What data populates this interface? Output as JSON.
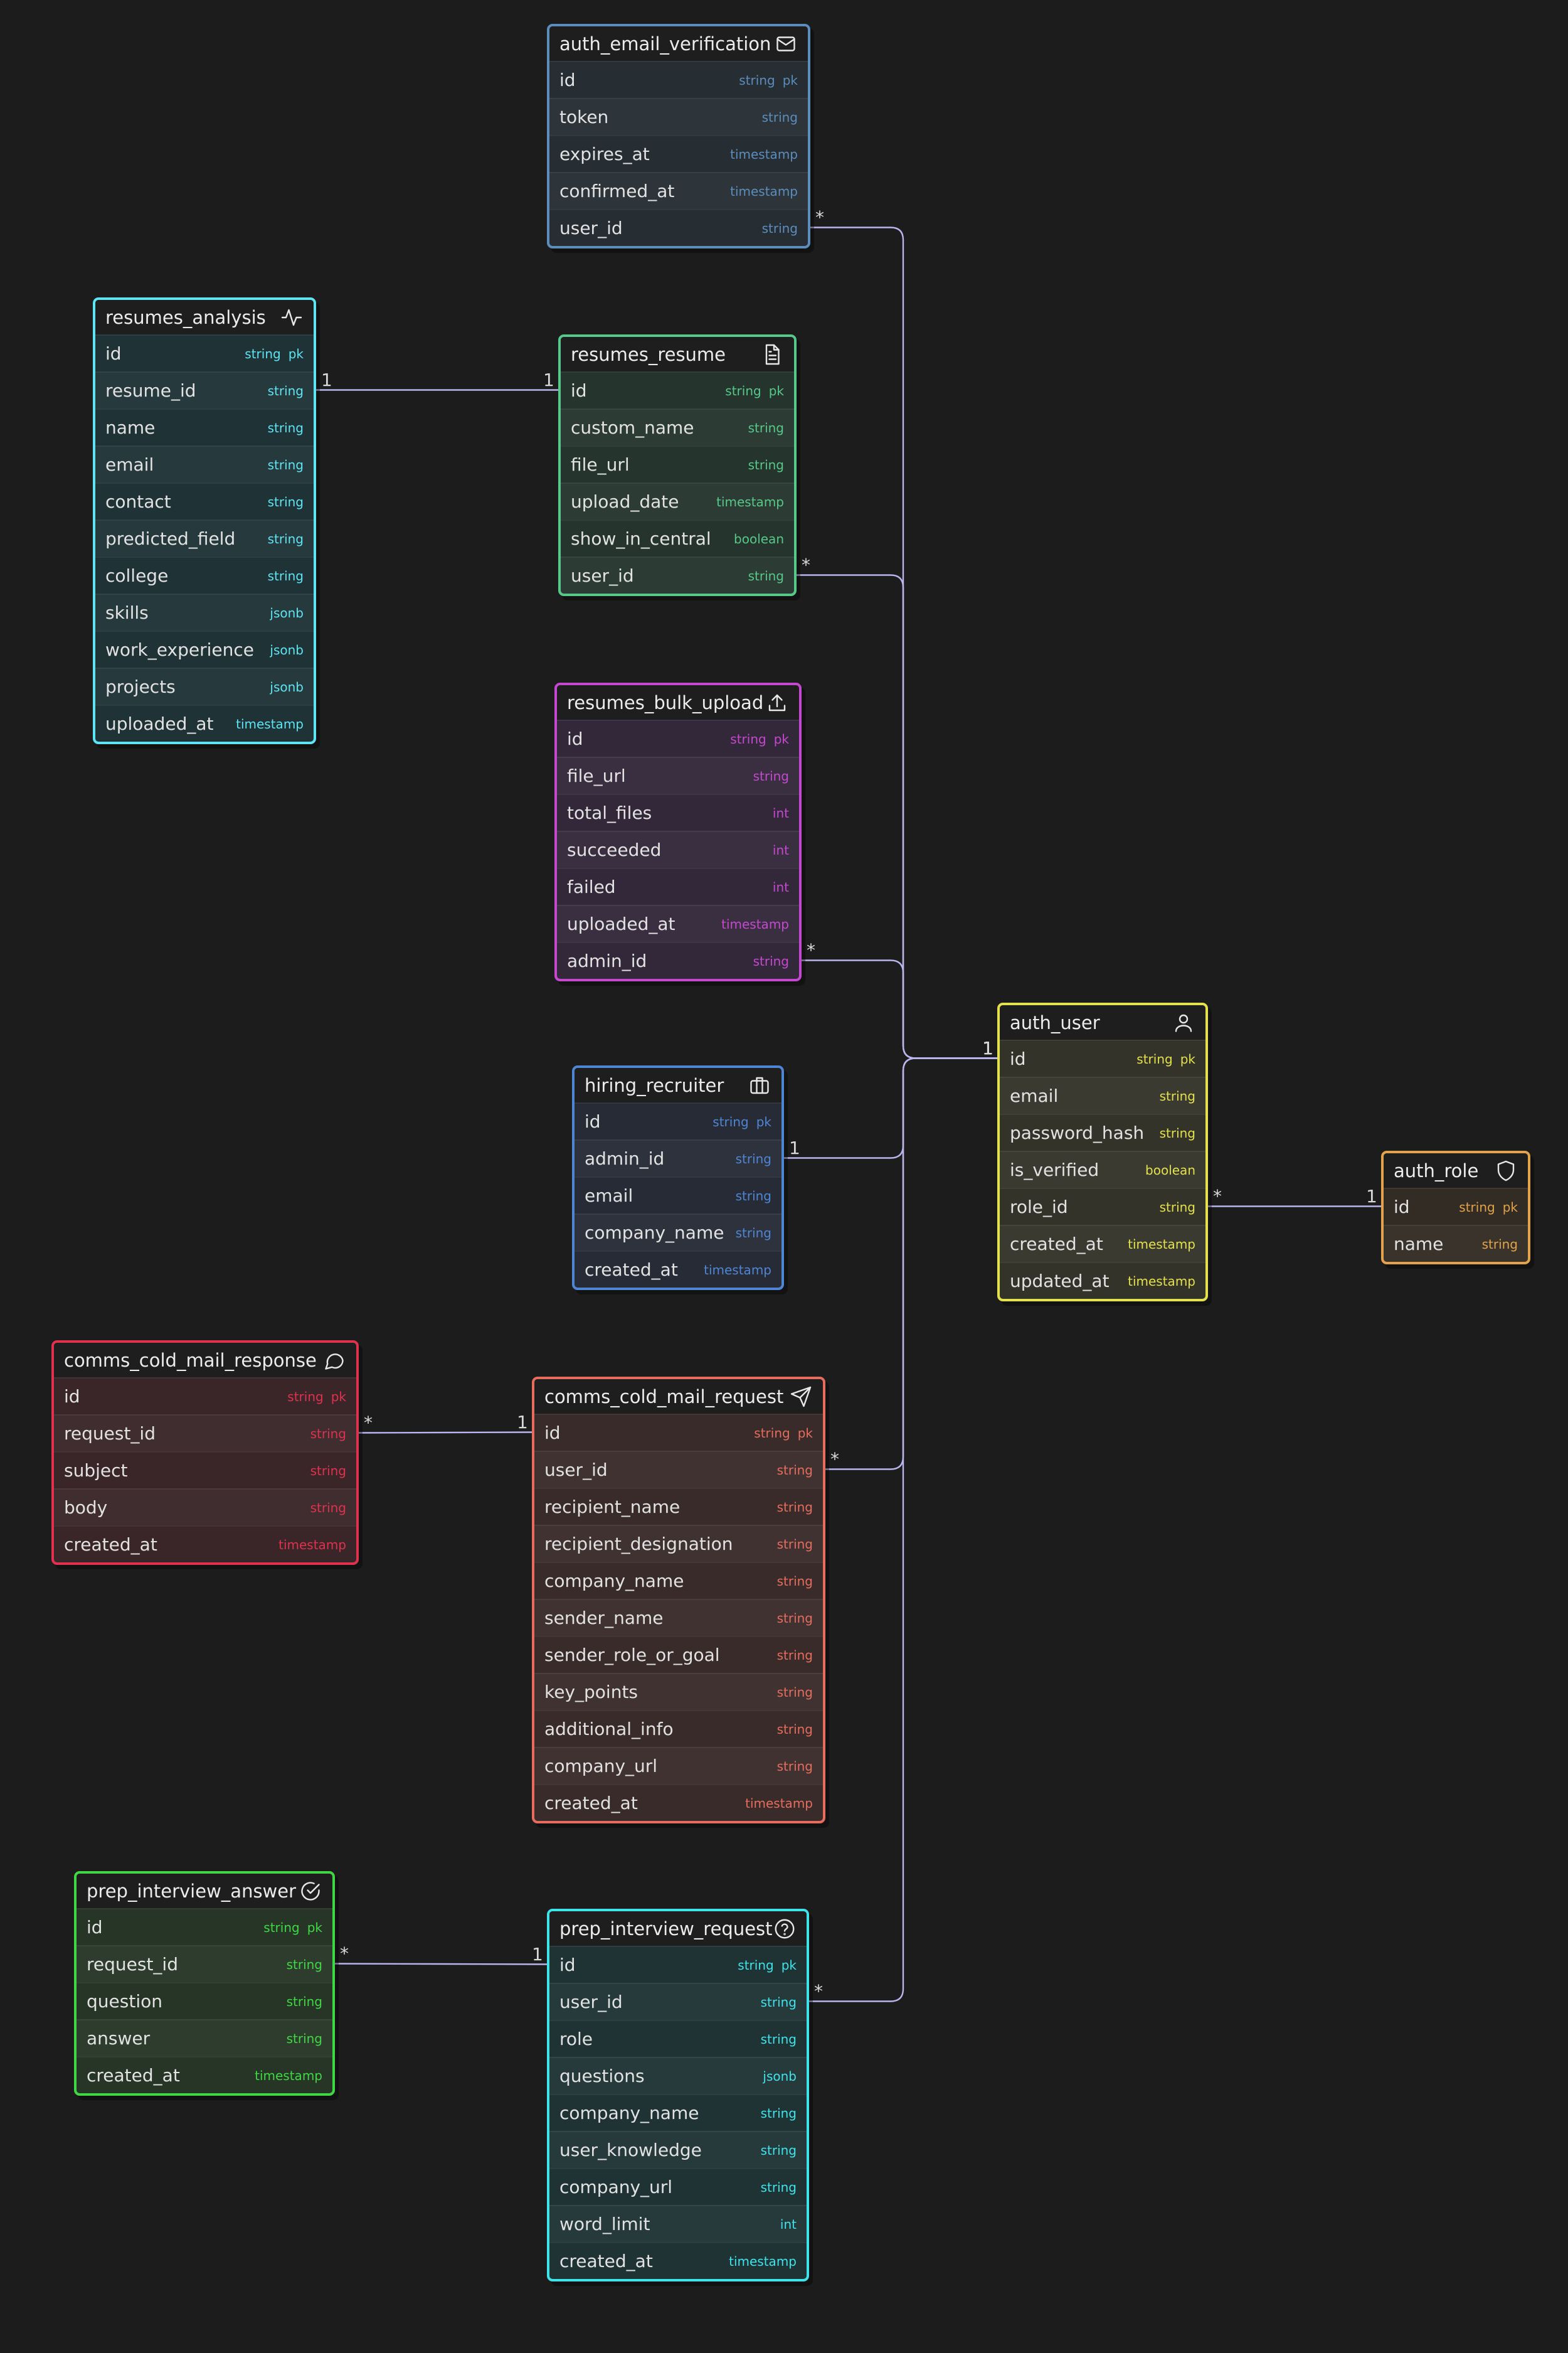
{
  "tables": [
    {
      "name": "auth_email_verification",
      "icon": "mail-icon",
      "color": "#5c8dbd",
      "bg": "#262e33",
      "fields": [
        {
          "name": "id",
          "type": "string",
          "pk": "pk"
        },
        {
          "name": "token",
          "type": "string"
        },
        {
          "name": "expires_at",
          "type": "timestamp"
        },
        {
          "name": "confirmed_at",
          "type": "timestamp"
        },
        {
          "name": "user_id",
          "type": "string"
        }
      ]
    },
    {
      "name": "resumes_analysis",
      "icon": "activity-icon",
      "color": "#5ee4f2",
      "bg": "#1f3236",
      "fields": [
        {
          "name": "id",
          "type": "string",
          "pk": "pk"
        },
        {
          "name": "resume_id",
          "type": "string"
        },
        {
          "name": "name",
          "type": "string"
        },
        {
          "name": "email",
          "type": "string"
        },
        {
          "name": "contact",
          "type": "string"
        },
        {
          "name": "predicted_field",
          "type": "string"
        },
        {
          "name": "college",
          "type": "string"
        },
        {
          "name": "skills",
          "type": "jsonb"
        },
        {
          "name": "work_experience",
          "type": "jsonb"
        },
        {
          "name": "projects",
          "type": "jsonb"
        },
        {
          "name": "uploaded_at",
          "type": "timestamp"
        }
      ]
    },
    {
      "name": "resumes_resume",
      "icon": "document-icon",
      "color": "#56c98a",
      "bg": "#25342c",
      "fields": [
        {
          "name": "id",
          "type": "string",
          "pk": "pk"
        },
        {
          "name": "custom_name",
          "type": "string"
        },
        {
          "name": "file_url",
          "type": "string"
        },
        {
          "name": "upload_date",
          "type": "timestamp"
        },
        {
          "name": "show_in_central",
          "type": "boolean"
        },
        {
          "name": "user_id",
          "type": "string"
        }
      ]
    },
    {
      "name": "resumes_bulk_upload",
      "icon": "upload-icon",
      "color": "#c548d0",
      "bg": "#33283a",
      "fields": [
        {
          "name": "id",
          "type": "string",
          "pk": "pk"
        },
        {
          "name": "file_url",
          "type": "string"
        },
        {
          "name": "total_files",
          "type": "int"
        },
        {
          "name": "succeeded",
          "type": "int"
        },
        {
          "name": "failed",
          "type": "int"
        },
        {
          "name": "uploaded_at",
          "type": "timestamp"
        },
        {
          "name": "admin_id",
          "type": "string"
        }
      ]
    },
    {
      "name": "hiring_recruiter",
      "icon": "briefcase-icon",
      "color": "#4f86d4",
      "bg": "#262b36",
      "fields": [
        {
          "name": "id",
          "type": "string",
          "pk": "pk"
        },
        {
          "name": "admin_id",
          "type": "string"
        },
        {
          "name": "email",
          "type": "string"
        },
        {
          "name": "company_name",
          "type": "string"
        },
        {
          "name": "created_at",
          "type": "timestamp"
        }
      ]
    },
    {
      "name": "auth_user",
      "icon": "user-icon",
      "color": "#e4e14c",
      "bg": "#33332a",
      "fields": [
        {
          "name": "id",
          "type": "string",
          "pk": "pk"
        },
        {
          "name": "email",
          "type": "string"
        },
        {
          "name": "password_hash",
          "type": "string"
        },
        {
          "name": "is_verified",
          "type": "boolean"
        },
        {
          "name": "role_id",
          "type": "string"
        },
        {
          "name": "created_at",
          "type": "timestamp"
        },
        {
          "name": "updated_at",
          "type": "timestamp"
        }
      ]
    },
    {
      "name": "auth_role",
      "icon": "shield-icon",
      "color": "#e2a34a",
      "bg": "#322c25",
      "fields": [
        {
          "name": "id",
          "type": "string",
          "pk": "pk"
        },
        {
          "name": "name",
          "type": "string"
        }
      ]
    },
    {
      "name": "comms_cold_mail_response",
      "icon": "message-icon",
      "color": "#e0314e",
      "bg": "#3a2629",
      "fields": [
        {
          "name": "id",
          "type": "string",
          "pk": "pk"
        },
        {
          "name": "request_id",
          "type": "string"
        },
        {
          "name": "subject",
          "type": "string"
        },
        {
          "name": "body",
          "type": "string"
        },
        {
          "name": "created_at",
          "type": "timestamp"
        }
      ]
    },
    {
      "name": "comms_cold_mail_request",
      "icon": "send-icon",
      "color": "#e66d5e",
      "bg": "#382b2a",
      "fields": [
        {
          "name": "id",
          "type": "string",
          "pk": "pk"
        },
        {
          "name": "user_id",
          "type": "string"
        },
        {
          "name": "recipient_name",
          "type": "string"
        },
        {
          "name": "recipient_designation",
          "type": "string"
        },
        {
          "name": "company_name",
          "type": "string"
        },
        {
          "name": "sender_name",
          "type": "string"
        },
        {
          "name": "sender_role_or_goal",
          "type": "string"
        },
        {
          "name": "key_points",
          "type": "string"
        },
        {
          "name": "additional_info",
          "type": "string"
        },
        {
          "name": "company_url",
          "type": "string"
        },
        {
          "name": "created_at",
          "type": "timestamp"
        }
      ]
    },
    {
      "name": "prep_interview_answer",
      "icon": "check-circle-icon",
      "color": "#3fd844",
      "bg": "#263526",
      "fields": [
        {
          "name": "id",
          "type": "string",
          "pk": "pk"
        },
        {
          "name": "request_id",
          "type": "string"
        },
        {
          "name": "question",
          "type": "string"
        },
        {
          "name": "answer",
          "type": "string"
        },
        {
          "name": "created_at",
          "type": "timestamp"
        }
      ]
    },
    {
      "name": "prep_interview_request",
      "icon": "help-circle-icon",
      "color": "#3fe3ea",
      "bg": "#1f3335",
      "fields": [
        {
          "name": "id",
          "type": "string",
          "pk": "pk"
        },
        {
          "name": "user_id",
          "type": "string"
        },
        {
          "name": "role",
          "type": "string"
        },
        {
          "name": "questions",
          "type": "jsonb"
        },
        {
          "name": "company_name",
          "type": "string"
        },
        {
          "name": "user_knowledge",
          "type": "string"
        },
        {
          "name": "company_url",
          "type": "string"
        },
        {
          "name": "word_limit",
          "type": "int"
        },
        {
          "name": "created_at",
          "type": "timestamp"
        }
      ]
    }
  ],
  "relations": [
    {
      "from": "auth_email_verification",
      "from_field": "user_id",
      "from_card": "*",
      "to": "auth_user",
      "to_field": "id",
      "to_card": "1"
    },
    {
      "from": "resumes_resume",
      "from_field": "user_id",
      "from_card": "*",
      "to": "auth_user",
      "to_field": "id",
      "to_card": "1"
    },
    {
      "from": "resumes_bulk_upload",
      "from_field": "admin_id",
      "from_card": "*",
      "to": "auth_user",
      "to_field": "id",
      "to_card": "1"
    },
    {
      "from": "hiring_recruiter",
      "from_field": "admin_id",
      "from_card": "1",
      "to": "auth_user",
      "to_field": "id",
      "to_card": "1"
    },
    {
      "from": "comms_cold_mail_request",
      "from_field": "user_id",
      "from_card": "*",
      "to": "auth_user",
      "to_field": "id",
      "to_card": "1"
    },
    {
      "from": "prep_interview_request",
      "from_field": "user_id",
      "from_card": "*",
      "to": "auth_user",
      "to_field": "id",
      "to_card": "1"
    },
    {
      "from": "resumes_analysis",
      "from_field": "resume_id",
      "from_card": "1",
      "to": "resumes_resume",
      "to_field": "id",
      "to_card": "1"
    },
    {
      "from": "auth_user",
      "from_field": "role_id",
      "from_card": "*",
      "to": "auth_role",
      "to_field": "id",
      "to_card": "1"
    },
    {
      "from": "comms_cold_mail_response",
      "from_field": "request_id",
      "from_card": "*",
      "to": "comms_cold_mail_request",
      "to_field": "id",
      "to_card": "1"
    },
    {
      "from": "prep_interview_answer",
      "from_field": "request_id",
      "from_card": "*",
      "to": "prep_interview_request",
      "to_field": "id",
      "to_card": "1"
    }
  ],
  "edge_color": "#b9b6ee"
}
